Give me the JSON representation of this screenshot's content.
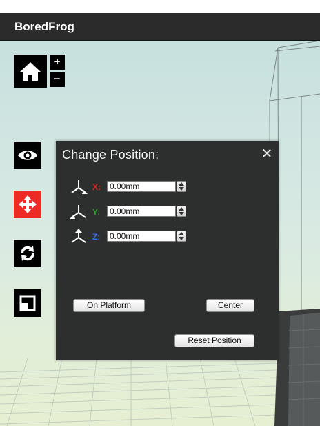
{
  "app": {
    "title": "BoredFrog"
  },
  "toolbar": {
    "home_icon": "home-icon",
    "zoom_in_label": "+",
    "zoom_out_label": "−",
    "view_icon": "eye-icon",
    "move_icon": "move-arrows-icon",
    "rotate_icon": "rotate-icon",
    "scale_icon": "scale-icon",
    "active_tool": "move"
  },
  "panel": {
    "title": "Change Position:",
    "close_label": "✕",
    "axes": [
      {
        "label": "X:",
        "value": "0.00mm",
        "color": "#e3241c"
      },
      {
        "label": "Y:",
        "value": "0.00mm",
        "color": "#2aa02a"
      },
      {
        "label": "Z:",
        "value": "0.00mm",
        "color": "#2f6fe8"
      }
    ],
    "on_platform_label": "On Platform",
    "center_label": "Center",
    "reset_label": "Reset Position"
  },
  "colors": {
    "accent_active": "#ee2a24",
    "panel_bg": "#2d2e2e",
    "titlebar_bg": "#2b2b2b"
  }
}
